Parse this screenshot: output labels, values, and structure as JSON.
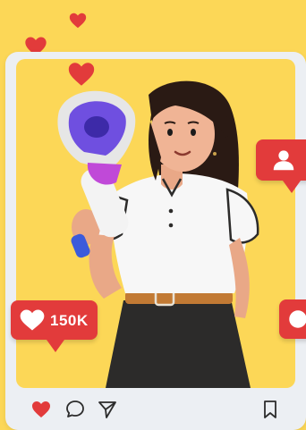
{
  "scene": {
    "background_color": "#fcd757",
    "accent_color": "#e23b3b",
    "frame_color": "#eceff3"
  },
  "like_notification": {
    "icon": "heart-icon",
    "count": "150K"
  },
  "follower_notification": {
    "icon": "user-icon"
  },
  "comment_notification": {
    "icon": "comment-icon"
  },
  "floating_hearts": [
    {
      "icon": "heart-icon"
    },
    {
      "icon": "heart-icon"
    },
    {
      "icon": "heart-icon"
    }
  ],
  "illustration": {
    "subject": "woman-with-megaphone",
    "megaphone_color": "#6f4fe0",
    "shirt_color": "#f7f7f7",
    "skirt_color": "#2c2b2a",
    "hair_color": "#2a1a14",
    "belt_color": "#c27a34"
  },
  "action_bar": {
    "like_icon": "heart-icon",
    "comment_icon": "comment-icon",
    "share_icon": "send-icon",
    "save_icon": "bookmark-icon"
  }
}
